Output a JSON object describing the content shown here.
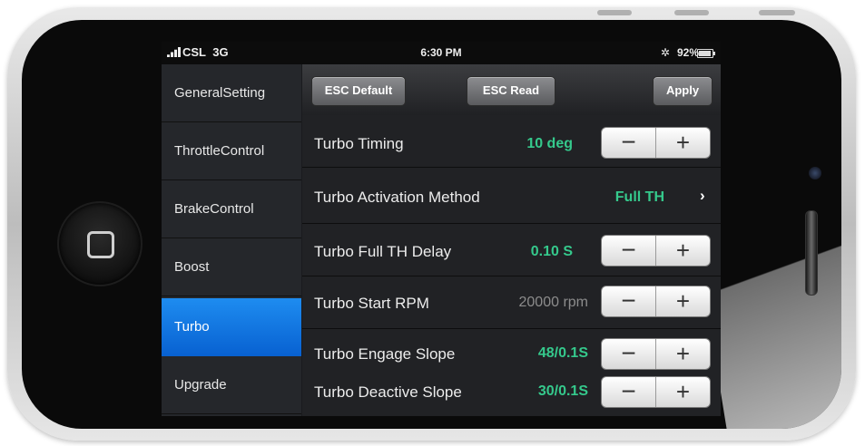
{
  "status_bar": {
    "carrier": "CSL",
    "network": "3G",
    "time": "6:30 PM",
    "battery": "92%"
  },
  "sidebar": {
    "items": [
      {
        "label": "GeneralSetting"
      },
      {
        "label": "ThrottleControl"
      },
      {
        "label": "BrakeControl"
      },
      {
        "label": "Boost"
      },
      {
        "label": "Turbo"
      },
      {
        "label": "Upgrade"
      }
    ]
  },
  "toolbar": {
    "esc_default_label": "ESC Default",
    "esc_read_label": "ESC Read",
    "apply_label": "Apply"
  },
  "settings": {
    "rows": [
      {
        "label": "Turbo Timing",
        "value": "10 deg"
      },
      {
        "label": "Turbo Activation Method",
        "value": "Full TH"
      },
      {
        "label": "Turbo Full TH Delay",
        "value": "0.10 S"
      },
      {
        "label": "Turbo Start RPM",
        "value": "20000 rpm"
      },
      {
        "label": "Turbo Engage Slope",
        "value": "48/0.1S"
      },
      {
        "label": "Turbo Deactive Slope",
        "value": "30/0.1S"
      }
    ],
    "minus_symbol": "−",
    "plus_symbol": "+",
    "chevron_symbol": "›"
  },
  "colors": {
    "value_green": "#35c98c",
    "active_blue": "#1e8cf0"
  }
}
